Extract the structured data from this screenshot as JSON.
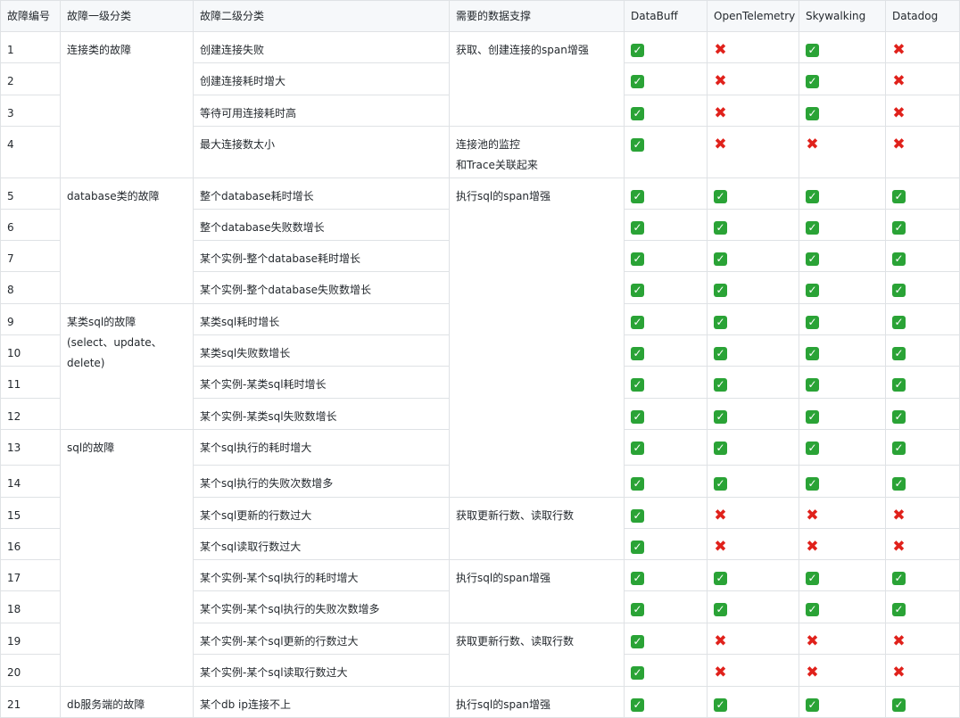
{
  "headers": [
    "故障编号",
    "故障一级分类",
    "故障二级分类",
    "需要的数据支撑",
    "DataBuff",
    "OpenTelemetry",
    "Skywalking",
    "Datadog"
  ],
  "rows": [
    {
      "id": "1",
      "level2": "创建连接失败",
      "support": [
        "✅",
        "❌",
        "✅",
        "❌"
      ]
    },
    {
      "id": "2",
      "level2": "创建连接耗时增大",
      "support": [
        "✅",
        "❌",
        "✅",
        "❌"
      ]
    },
    {
      "id": "3",
      "level2": "等待可用连接耗时高",
      "support": [
        "✅",
        "❌",
        "✅",
        "❌"
      ]
    },
    {
      "id": "4",
      "level2": "最大连接数太小",
      "support": [
        "✅",
        "❌",
        "❌",
        "❌"
      ]
    },
    {
      "id": "5",
      "level2": "整个database耗时增长",
      "support": [
        "✅",
        "✅",
        "✅",
        "✅"
      ]
    },
    {
      "id": "6",
      "level2": "整个database失败数增长",
      "support": [
        "✅",
        "✅",
        "✅",
        "✅"
      ]
    },
    {
      "id": "7",
      "level2": "某个实例-整个database耗时增长",
      "support": [
        "✅",
        "✅",
        "✅",
        "✅"
      ]
    },
    {
      "id": "8",
      "level2": "某个实例-整个database失败数增长",
      "support": [
        "✅",
        "✅",
        "✅",
        "✅"
      ]
    },
    {
      "id": "9",
      "level2": "某类sql耗时增长",
      "support": [
        "✅",
        "✅",
        "✅",
        "✅"
      ]
    },
    {
      "id": "10",
      "level2": "某类sql失败数增长",
      "support": [
        "✅",
        "✅",
        "✅",
        "✅"
      ]
    },
    {
      "id": "11",
      "level2": "某个实例-某类sql耗时增长",
      "support": [
        "✅",
        "✅",
        "✅",
        "✅"
      ]
    },
    {
      "id": "12",
      "level2": "某个实例-某类sql失败数增长",
      "support": [
        "✅",
        "✅",
        "✅",
        "✅"
      ]
    },
    {
      "id": "13",
      "level2": "某个sql执行的耗时增大",
      "support": [
        "✅",
        "✅",
        "✅",
        "✅"
      ]
    },
    {
      "id": "14",
      "level2": "某个sql执行的失败次数增多",
      "support": [
        "✅",
        "✅",
        "✅",
        "✅"
      ]
    },
    {
      "id": "15",
      "level2": "某个sql更新的行数过大",
      "support": [
        "✅",
        "❌",
        "❌",
        "❌"
      ]
    },
    {
      "id": "16",
      "level2": "某个sql读取行数过大",
      "support": [
        "✅",
        "❌",
        "❌",
        "❌"
      ]
    },
    {
      "id": "17",
      "level2": "某个实例-某个sql执行的耗时增大",
      "support": [
        "✅",
        "✅",
        "✅",
        "✅"
      ]
    },
    {
      "id": "18",
      "level2": "某个实例-某个sql执行的失败次数增多",
      "support": [
        "✅",
        "✅",
        "✅",
        "✅"
      ]
    },
    {
      "id": "19",
      "level2": "某个实例-某个sql更新的行数过大",
      "support": [
        "✅",
        "❌",
        "❌",
        "❌"
      ]
    },
    {
      "id": "20",
      "level2": "某个实例-某个sql读取行数过大",
      "support": [
        "✅",
        "❌",
        "❌",
        "❌"
      ]
    },
    {
      "id": "21",
      "level2": "某个db ip连接不上",
      "support": [
        "✅",
        "✅",
        "✅",
        "✅"
      ]
    }
  ],
  "level1_groups": [
    {
      "first_row": 0,
      "row_count": 4,
      "lines": [
        "连接类的故障"
      ]
    },
    {
      "first_row": 4,
      "row_count": 4,
      "lines": [
        "database类的故障"
      ]
    },
    {
      "first_row": 8,
      "row_count": 4,
      "lines": [
        "某类sql的故障",
        "(select、update、",
        "delete)"
      ]
    },
    {
      "first_row": 12,
      "row_count": 8,
      "lines": [
        "sql的故障"
      ]
    },
    {
      "first_row": 20,
      "row_count": 1,
      "lines": [
        "db服务端的故障"
      ]
    }
  ],
  "data_groups": [
    {
      "first_row": 0,
      "row_count": 3,
      "lines": [
        "获取、创建连接的span增强"
      ]
    },
    {
      "first_row": 3,
      "row_count": 1,
      "lines": [
        "连接池的监控",
        "和Trace关联起来"
      ]
    },
    {
      "first_row": 4,
      "row_count": 10,
      "lines": [
        "执行sql的span增强"
      ]
    },
    {
      "first_row": 14,
      "row_count": 2,
      "lines": [
        "获取更新行数、读取行数"
      ]
    },
    {
      "first_row": 16,
      "row_count": 2,
      "lines": [
        "执行sql的span增强"
      ]
    },
    {
      "first_row": 18,
      "row_count": 2,
      "lines": [
        "获取更新行数、读取行数"
      ]
    },
    {
      "first_row": 20,
      "row_count": 1,
      "lines": [
        "执行sql的span增强"
      ]
    }
  ],
  "colors": {
    "check": "#2aa336",
    "cross": "#e0211b",
    "header_bg": "#f6f8fa",
    "border": "#dfe2e5"
  }
}
